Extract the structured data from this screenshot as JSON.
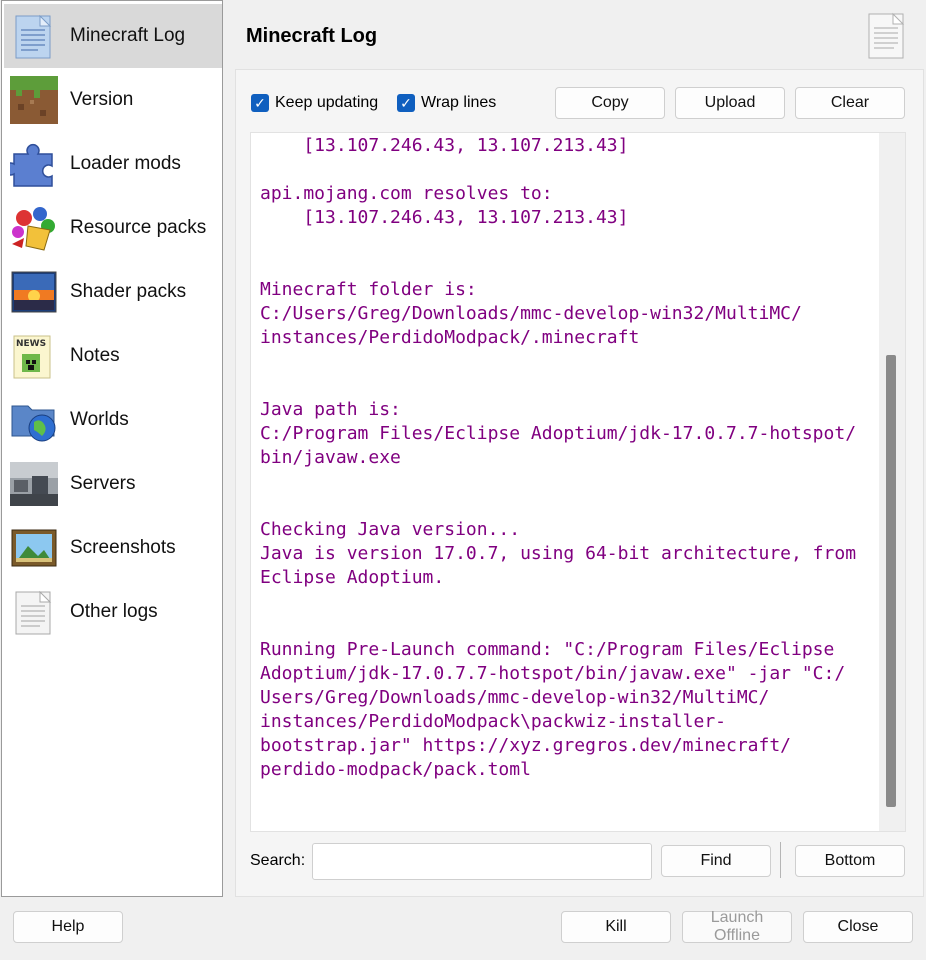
{
  "header": {
    "title": "Minecraft Log"
  },
  "sidebar": {
    "items": [
      {
        "label": "Minecraft Log",
        "icon": "log-icon",
        "selected": true
      },
      {
        "label": "Version",
        "icon": "grass-block-icon"
      },
      {
        "label": "Loader mods",
        "icon": "puzzle-icon"
      },
      {
        "label": "Resource packs",
        "icon": "paint-bucket-icon"
      },
      {
        "label": "Shader packs",
        "icon": "sunset-icon"
      },
      {
        "label": "Notes",
        "icon": "news-icon"
      },
      {
        "label": "Worlds",
        "icon": "globe-folder-icon"
      },
      {
        "label": "Servers",
        "icon": "server-icon"
      },
      {
        "label": "Screenshots",
        "icon": "picture-icon"
      },
      {
        "label": "Other logs",
        "icon": "document-icon"
      }
    ]
  },
  "toolbar": {
    "keep_updating": {
      "label": "Keep updating",
      "checked": true
    },
    "wrap_lines": {
      "label": "Wrap lines",
      "checked": true
    },
    "copy": "Copy",
    "upload": "Upload",
    "clear": "Clear"
  },
  "log": {
    "color": "#800080",
    "lines": [
      "    [13.107.246.43, 13.107.213.43]",
      "",
      "api.mojang.com resolves to:",
      "    [13.107.246.43, 13.107.213.43]",
      "",
      "",
      "Minecraft folder is:",
      "C:/Users/Greg/Downloads/mmc-develop-win32/MultiMC/",
      "instances/PerdidoModpack/.minecraft",
      "",
      "",
      "Java path is:",
      "C:/Program Files/Eclipse Adoptium/jdk-17.0.7.7-hotspot/",
      "bin/javaw.exe",
      "",
      "",
      "Checking Java version...",
      "Java is version 17.0.7, using 64-bit architecture, from",
      "Eclipse Adoptium.",
      "",
      "",
      "Running Pre-Launch command: \"C:/Program Files/Eclipse",
      "Adoptium/jdk-17.0.7.7-hotspot/bin/javaw.exe\" -jar \"C:/",
      "Users/Greg/Downloads/mmc-develop-win32/MultiMC/",
      "instances/PerdidoModpack\\packwiz-installer-",
      "bootstrap.jar\" https://xyz.gregros.dev/minecraft/",
      "perdido-modpack/pack.toml"
    ]
  },
  "search": {
    "label": "Search:",
    "value": "",
    "find": "Find",
    "bottom": "Bottom"
  },
  "footer": {
    "help": "Help",
    "kill": "Kill",
    "launch_offline": "Launch Offline",
    "close": "Close"
  }
}
